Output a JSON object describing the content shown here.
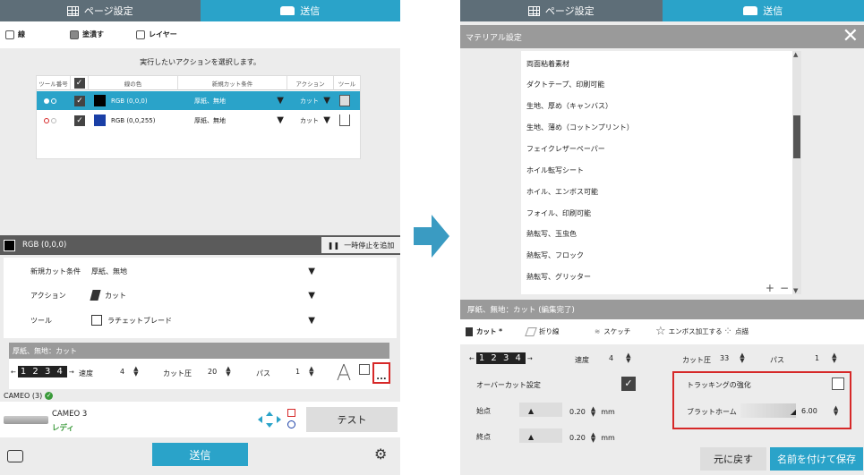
{
  "left": {
    "tabs": [
      {
        "label": "ページ設定"
      },
      {
        "label": "送信"
      }
    ],
    "subtabs": [
      {
        "label": "線"
      },
      {
        "label": "塗潰す"
      },
      {
        "label": "レイヤー"
      }
    ],
    "prompt": "実行したいアクションを選択します。",
    "table": {
      "headers": [
        "ツール番号",
        "",
        "線の色",
        "新規カット条件",
        "アクション",
        "ツール"
      ],
      "rows": [
        {
          "color_label": "RGB (0,0,0)",
          "material": "厚紙、無地",
          "action": "カット",
          "swatch": "#000000",
          "selected": true
        },
        {
          "color_label": "RGB (0,0,255)",
          "material": "厚紙、無地",
          "action": "カット",
          "swatch": "#1a3fa6",
          "selected": false
        }
      ]
    },
    "color_bar": {
      "label": "RGB (0,0,0)",
      "pause_label": "一時停止を追加"
    },
    "settings": {
      "material_label": "新規カット条件",
      "material_value": "厚紙、無地",
      "action_label": "アクション",
      "action_value": "カット",
      "tool_label": "ツール",
      "tool_value": "ラチェットブレード"
    },
    "cut_panel": {
      "header": "厚紙、無地：カット",
      "digits": "1 2 3 4",
      "speed_label": "速度",
      "speed_value": "4",
      "force_label": "カット圧",
      "force_value": "20",
      "pass_label": "パス",
      "pass_value": "1",
      "more_label": "..."
    },
    "device": {
      "header": "CAMEO (3)",
      "name": "CAMEO 3",
      "status": "レディ",
      "test_label": "テスト"
    },
    "send_label": "送信"
  },
  "right": {
    "tabs": [
      {
        "label": "ページ設定"
      },
      {
        "label": "送信"
      }
    ],
    "title": "マテリアル設定",
    "materials": [
      "両面粘着素材",
      "ダクトテープ、印刷可能",
      "生地、厚め（キャンバス）",
      "生地、薄め（コットンプリント）",
      "フェイクレザーペーパー",
      "ホイル転写シート",
      "ホイル、エンボス可能",
      "フォイル、印刷可能",
      "熱転写、玉虫色",
      "熱転写、フロック",
      "熱転写、グリッター"
    ],
    "list_buttons": {
      "add": "+",
      "remove": "−"
    },
    "material_header": "厚紙、無地：カット (編集完了)",
    "subtabs": [
      {
        "label": "カット *"
      },
      {
        "label": "折り線"
      },
      {
        "label": "スケッチ"
      },
      {
        "label": "エンボス加工する"
      },
      {
        "label": "点描"
      }
    ],
    "controls": {
      "digits": "1 2 3 4",
      "speed_label": "速度",
      "speed_value": "4",
      "force_label": "カット圧",
      "force_value": "33",
      "pass_label": "パス",
      "pass_value": "1",
      "overcut_label": "オーバーカット設定",
      "tracking_label": "トラッキングの強化",
      "start_label": "始点",
      "start_value": "0.20",
      "start_unit": "mm",
      "end_label": "終点",
      "end_value": "0.20",
      "end_unit": "mm",
      "blade_label": "ブラットホーム",
      "blade_value": "6.00"
    },
    "buttons": {
      "revert": "元に戻す",
      "save": "名前を付けて保存"
    }
  },
  "colors": {
    "accent": "#2aa3c9",
    "tab_inactive": "#5e6e78",
    "highlight_red": "#d62828",
    "arrow": "#3a9bc2"
  }
}
